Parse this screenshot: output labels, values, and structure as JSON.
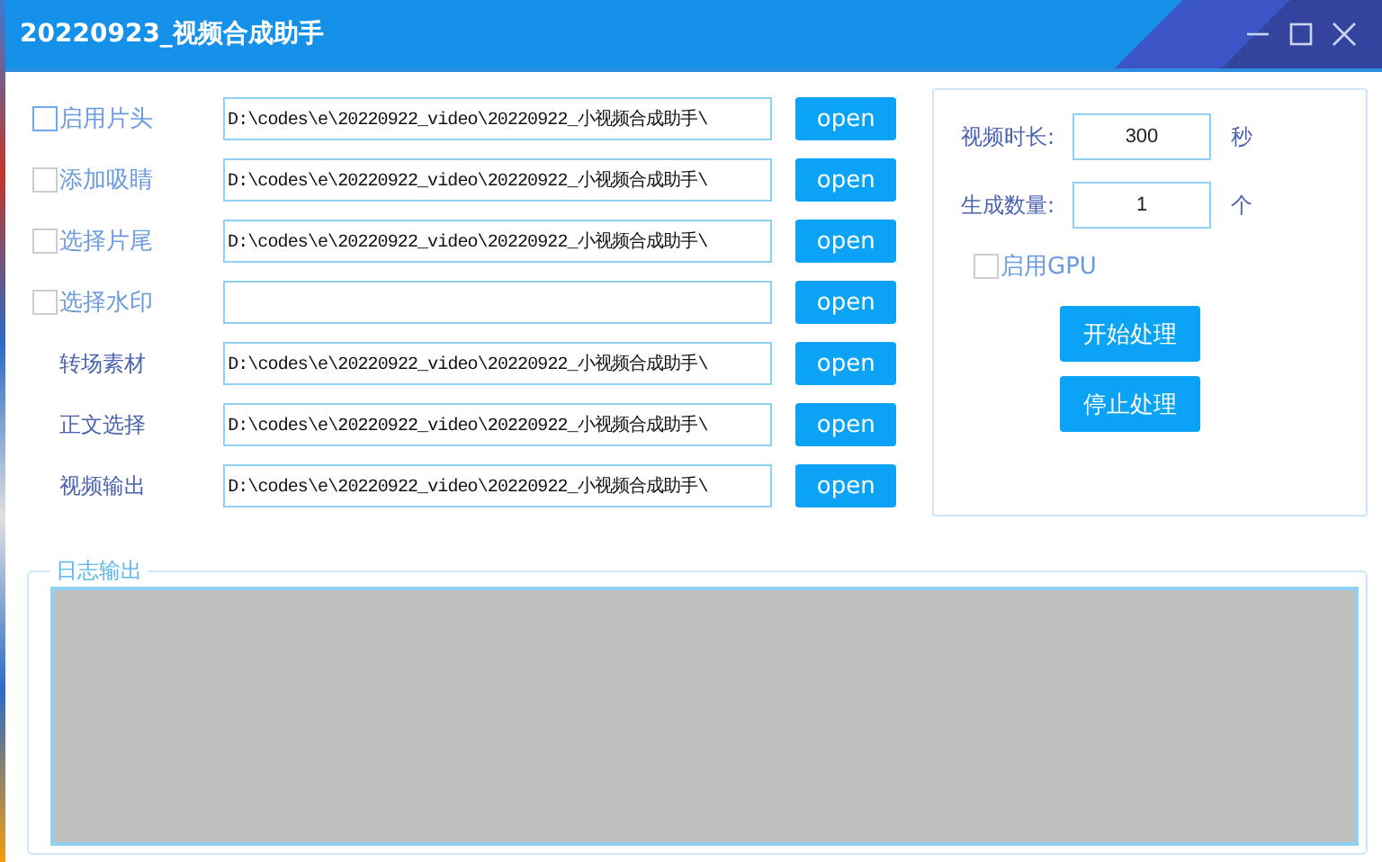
{
  "window": {
    "title": "20220923_视频合成助手"
  },
  "rows": [
    {
      "kind": "checkbox",
      "label": "启用片头",
      "checked": false,
      "path": "D:\\codes\\e\\20220922_video\\20220922_小视频合成助手\\",
      "button": "open"
    },
    {
      "kind": "checkbox",
      "label": "添加吸睛",
      "checked": false,
      "path": "D:\\codes\\e\\20220922_video\\20220922_小视频合成助手\\",
      "button": "open"
    },
    {
      "kind": "checkbox",
      "label": "选择片尾",
      "checked": false,
      "path": "D:\\codes\\e\\20220922_video\\20220922_小视频合成助手\\",
      "button": "open"
    },
    {
      "kind": "checkbox",
      "label": "选择水印",
      "checked": false,
      "path": "",
      "button": "open"
    },
    {
      "kind": "label",
      "label": "转场素材",
      "path": "D:\\codes\\e\\20220922_video\\20220922_小视频合成助手\\",
      "button": "open"
    },
    {
      "kind": "label",
      "label": "正文选择",
      "path": "D:\\codes\\e\\20220922_video\\20220922_小视频合成助手\\",
      "button": "open"
    },
    {
      "kind": "label",
      "label": "视频输出",
      "path": "D:\\codes\\e\\20220922_video\\20220922_小视频合成助手\\",
      "button": "open"
    }
  ],
  "settings": {
    "fields": [
      {
        "label": "视频时长:",
        "value": "300",
        "unit": "秒"
      },
      {
        "label": "生成数量:",
        "value": "1",
        "unit": "个"
      }
    ],
    "gpu": {
      "label": "启用GPU",
      "checked": false
    },
    "buttons": [
      "开始处理",
      "停止处理"
    ]
  },
  "log": {
    "title": "日志输出"
  }
}
